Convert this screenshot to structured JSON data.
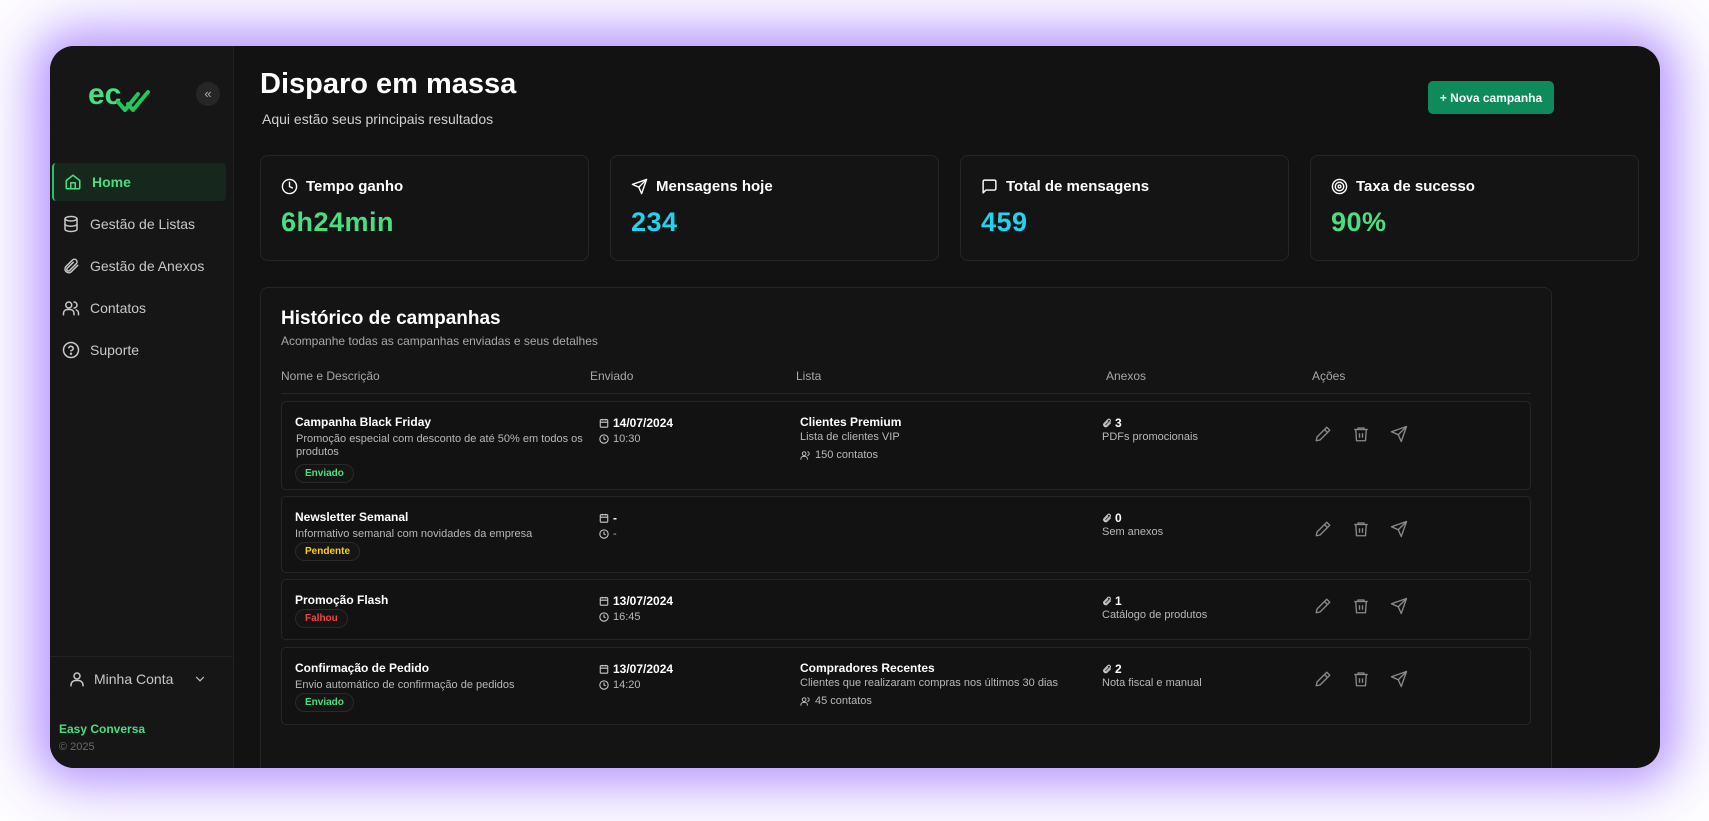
{
  "sidebar": {
    "items": [
      {
        "label": "Home",
        "icon": "home-icon"
      },
      {
        "label": "Gestão de Listas",
        "icon": "database-icon"
      },
      {
        "label": "Gestão de Anexos",
        "icon": "paperclip-icon"
      },
      {
        "label": "Contatos",
        "icon": "users-icon"
      },
      {
        "label": "Suporte",
        "icon": "help-circle-icon"
      }
    ],
    "account_label": "Minha Conta",
    "brand": "Easy Conversa",
    "copyright": "© 2025"
  },
  "header": {
    "title": "Disparo em massa",
    "subtitle": "Aqui estão seus principais resultados",
    "new_campaign_label": "+ Nova campanha"
  },
  "stats": [
    {
      "label": "Tempo ganho",
      "value": "6h24min",
      "color": "#4ade80",
      "icon": "clock-icon"
    },
    {
      "label": "Mensagens hoje",
      "value": "234",
      "color": "#22d3ee",
      "icon": "send-icon"
    },
    {
      "label": "Total de mensagens",
      "value": "459",
      "color": "#22d3ee",
      "icon": "message-icon"
    },
    {
      "label": "Taxa de sucesso",
      "value": "90%",
      "color": "#4ade80",
      "icon": "target-icon"
    }
  ],
  "history": {
    "title": "Histórico de campanhas",
    "subtitle": "Acompanhe todas as campanhas enviadas e seus detalhes",
    "columns": [
      "Nome e Descrição",
      "Enviado",
      "Lista",
      "Anexos",
      "Ações"
    ],
    "rows": [
      {
        "name": "Campanha Black Friday",
        "description": "Promoção especial com desconto de até 50% em todos os produtos",
        "status": "Enviado",
        "date": "14/07/2024",
        "time": "10:30",
        "list_name": "Clientes Premium",
        "list_desc": "Lista de clientes VIP",
        "list_count": "150 contatos",
        "attachments": "3",
        "attachments_desc": "PDFs promocionais"
      },
      {
        "name": "Newsletter Semanal",
        "description": "Informativo semanal com novidades da empresa",
        "status": "Pendente",
        "date": "-",
        "time": "-",
        "attachments": "0",
        "attachments_desc": "Sem anexos"
      },
      {
        "name": "Promoção Flash",
        "status": "Falhou",
        "date": "13/07/2024",
        "time": "16:45",
        "attachments": "1",
        "attachments_desc": "Catálogo de produtos"
      },
      {
        "name": "Confirmação de Pedido",
        "description": "Envio automático de confirmação de pedidos",
        "status": "Enviado",
        "date": "13/07/2024",
        "time": "14:20",
        "list_name": "Compradores Recentes",
        "list_desc": "Clientes que realizaram compras nos últimos 30 dias",
        "list_count": "45 contatos",
        "attachments": "2",
        "attachments_desc": "Nota fiscal e manual"
      }
    ]
  },
  "colors": {
    "accent": "#22c55e",
    "button": "#0f8a5a",
    "cyan": "#22d3ee",
    "pending": "#facc15",
    "failed": "#ef4444",
    "glow": "#a078ff"
  }
}
